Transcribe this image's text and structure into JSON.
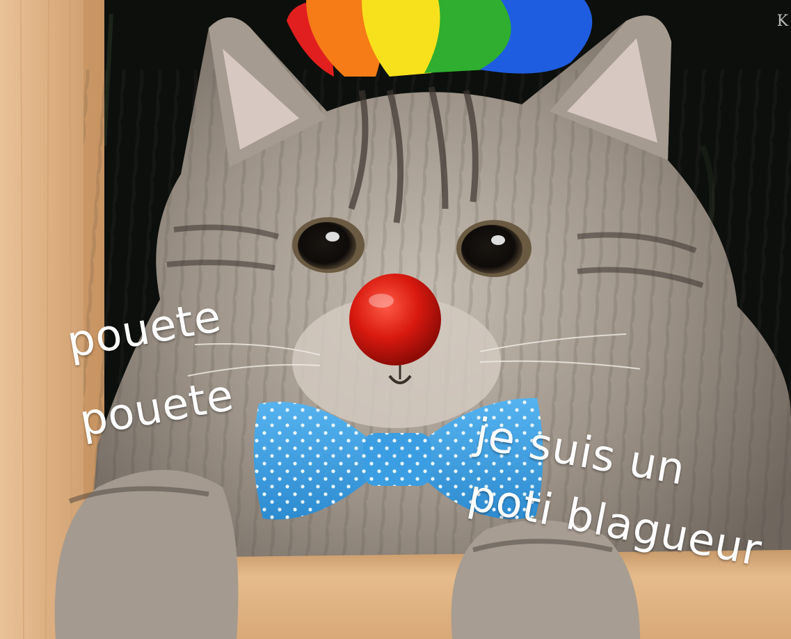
{
  "meme": {
    "caption_left_line1": "pouete",
    "caption_left_line2": "pouete",
    "caption_right_line1": "je suis un",
    "caption_right_line2": "poti blagueur",
    "corner_mark": "K"
  },
  "colors": {
    "background": "#0c0f0c",
    "wood": "#e2b689",
    "fur": "#9a8f84",
    "nose": "#d21d14",
    "bowtie": "#3fa0e0",
    "caption_text": "#ffffff"
  },
  "icons": {
    "clown_hat": "rainbow-clown-wig",
    "clown_nose": "red-ball-nose",
    "bow_tie": "polka-dot-bow-tie"
  }
}
